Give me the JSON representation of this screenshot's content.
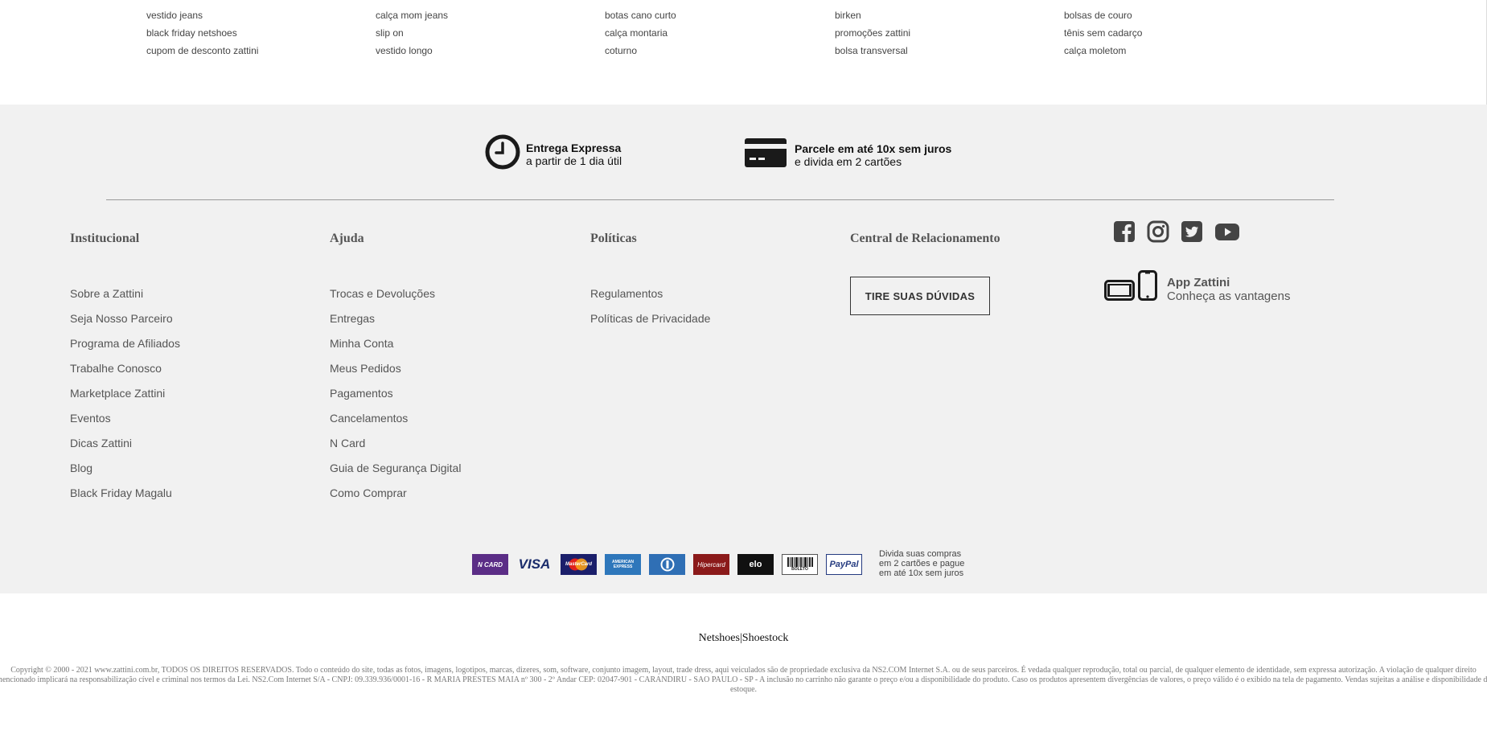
{
  "keywords": [
    [
      "vestido jeans",
      "black friday netshoes",
      "cupom de desconto zattini"
    ],
    [
      "calça mom jeans",
      "slip on",
      "vestido longo"
    ],
    [
      "botas cano curto",
      "calça montaria",
      "coturno"
    ],
    [
      "birken",
      "promoções zattini",
      "bolsa transversal"
    ],
    [
      "bolsas de couro",
      "tênis sem cadarço",
      "calça moletom"
    ]
  ],
  "benefits": {
    "delivery": {
      "title": "Entrega Expressa",
      "subtitle": "a partir de 1 dia útil",
      "icon": "clock-icon"
    },
    "installments": {
      "title": "Parcele em até 10x sem juros",
      "subtitle": "e divida em 2 cartões",
      "icon": "credit-card-icon"
    }
  },
  "columns": {
    "institucional": {
      "title": "Institucional",
      "links": [
        "Sobre a Zattini",
        "Seja Nosso Parceiro",
        "Programa de Afiliados",
        "Trabalhe Conosco",
        "Marketplace Zattini",
        "Eventos",
        "Dicas Zattini",
        "Blog",
        "Black Friday Magalu"
      ]
    },
    "ajuda": {
      "title": "Ajuda",
      "links": [
        "Trocas e Devoluções",
        "Entregas",
        "Minha Conta",
        "Meus Pedidos",
        "Pagamentos",
        "Cancelamentos",
        "N Card",
        "Guia de Segurança Digital",
        "Como Comprar"
      ]
    },
    "politicas": {
      "title": "Políticas",
      "links": [
        "Regulamentos",
        "Políticas de Privacidade"
      ]
    },
    "central": {
      "title": "Central de Relacionamento",
      "button": "TIRE SUAS DÚVIDAS"
    }
  },
  "social": [
    "facebook-icon",
    "instagram-icon",
    "twitter-icon",
    "youtube-icon"
  ],
  "app": {
    "title": "App Zattini",
    "subtitle": "Conheça as vantagens"
  },
  "payments": {
    "methods": [
      "N CARD",
      "VISA",
      "MasterCard",
      "AMERICAN EXPRESS",
      "Diners",
      "Hipercard",
      "elo",
      "BOLETO",
      "PayPal"
    ],
    "note": [
      "Divida suas compras",
      "em 2 cartões e pague",
      "em até 10x sem juros"
    ]
  },
  "brands": {
    "first": "Netshoes",
    "separator": "|",
    "second": "Shoestock"
  },
  "copyright": "Copyright © 2000 - 2021 www.zattini.com.br, TODOS OS DIREITOS RESERVADOS. Todo o conteúdo do site, todas as fotos, imagens, logotipos, marcas, dizeres, som, software, conjunto imagem, layout, trade dress, aqui veiculados são de propriedade exclusiva da NS2.COM Internet S.A. ou de seus parceiros. É vedada qualquer reprodução, total ou parcial, de qualquer elemento de identidade, sem expressa autorização. A violação de qualquer direito mencionado implicará na responsabilização cível e criminal nos termos da Lei. NS2.Com Internet S/A - CNPJ: 09.339.936/0001-16 - R MARIA PRESTES MAIA nº 300 - 2º Andar CEP: 02047-901 - CARANDIRU - SAO PAULO - SP - A inclusão no carrinho não garante o preço e/ou a disponibilidade do produto. Caso os produtos apresentem divergências de valores, o preço válido é o exibido na tela de pagamento. Vendas sujeitas a análise e disponibilidade de estoque.",
  "colors": {
    "footer_bg": "#f1f1f1",
    "ncard": "#5b2d86",
    "mastercard": "#1b1f6b",
    "amex": "#2e77bb",
    "diners": "#2f6fb5",
    "hipercard": "#8b1a1a",
    "elo": "#111111",
    "paypal": "#253b80"
  }
}
